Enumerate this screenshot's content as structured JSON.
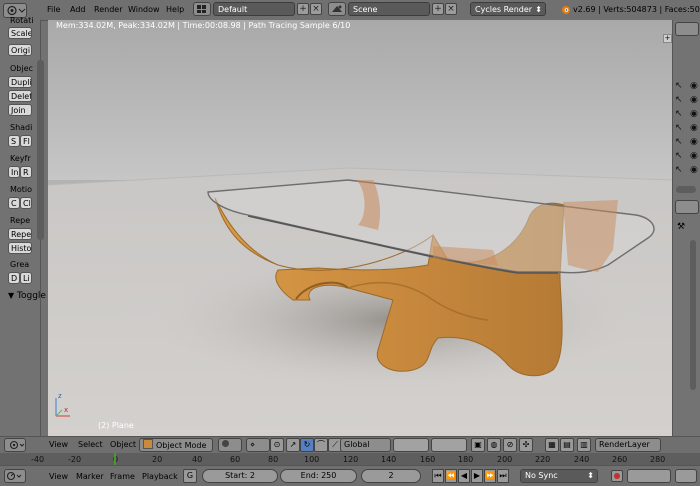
{
  "topbar": {
    "menus": [
      "File",
      "Add",
      "Render",
      "Window",
      "Help"
    ],
    "layout_value": "Default",
    "scene_value": "Scene",
    "engine_value": "Cycles Render",
    "stats": "v2.69 | Verts:504873 | Faces:504"
  },
  "viewport": {
    "info_text": "Mem:334.02M, Peak:334.02M | Time:00:08.98 | Path Tracing Sample 6/10",
    "object_label": "(2) Plane",
    "axis_x": "x",
    "axis_z": "z"
  },
  "toolshelf": {
    "items": [
      {
        "type": "label",
        "text": "Rotati"
      },
      {
        "type": "button",
        "text": "Scale"
      },
      {
        "type": "button",
        "text": "Origi"
      },
      {
        "type": "label",
        "text": "Objec"
      },
      {
        "type": "button",
        "text": "Dupli"
      },
      {
        "type": "button",
        "text": "Delet"
      },
      {
        "type": "button",
        "text": "Join"
      },
      {
        "type": "label",
        "text": "Shadi"
      },
      {
        "type": "pair",
        "a": "S",
        "b": "Fl"
      },
      {
        "type": "label",
        "text": "Keyfr"
      },
      {
        "type": "pair",
        "a": "In",
        "b": "R"
      },
      {
        "type": "label",
        "text": "Motio"
      },
      {
        "type": "pair",
        "a": "C",
        "b": "Cl"
      },
      {
        "type": "label",
        "text": "Repe"
      },
      {
        "type": "button",
        "text": "Repe"
      },
      {
        "type": "button",
        "text": "Histo"
      },
      {
        "type": "label",
        "text": "Grea"
      },
      {
        "type": "pair",
        "a": "D",
        "b": "Li"
      }
    ],
    "toggle_label": "Toggle"
  },
  "view_header": {
    "menus": [
      "View",
      "Select",
      "Object"
    ],
    "mode_value": "Object Mode",
    "orientation_value": "Global",
    "layer_value": "RenderLayer"
  },
  "ruler": {
    "ticks": [
      "-40",
      "-20",
      "0",
      "20",
      "40",
      "60",
      "80",
      "100",
      "120",
      "140",
      "160",
      "180",
      "200",
      "220",
      "240",
      "260",
      "280"
    ]
  },
  "timeline": {
    "menus": [
      "View",
      "Marker",
      "Frame",
      "Playback"
    ],
    "start_label": "Start: 2",
    "end_label": "End: 250",
    "current_frame": "2",
    "sync_value": "No Sync"
  },
  "colors": {
    "ui_gray": "#727272",
    "field_dark": "#5a5a5a",
    "wood": "#c98a3e",
    "floor": "#c8c5c2",
    "playhead": "#4a9a2b"
  }
}
